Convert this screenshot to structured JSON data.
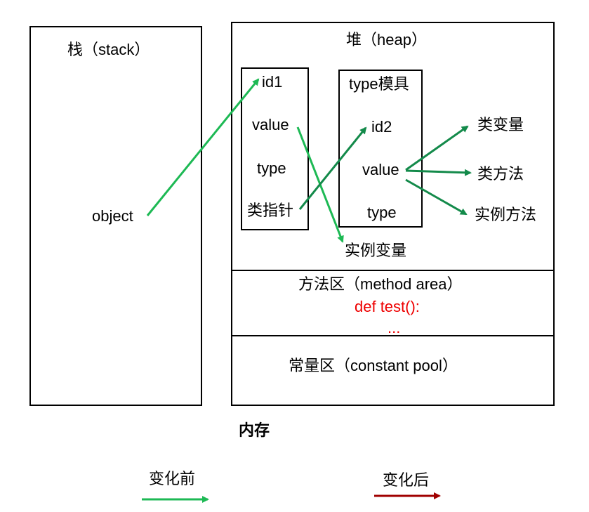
{
  "stack": {
    "title": "栈（stack）",
    "object": "object"
  },
  "heap": {
    "title": "堆（heap）",
    "obj1": {
      "id": "id1",
      "value": "value",
      "type": "type",
      "class_ptr": "类指针"
    },
    "obj2": {
      "type_template": "type模具",
      "id": "id2",
      "value": "value",
      "type": "type"
    },
    "instance_var": "实例变量",
    "class_var": "类变量",
    "class_method": "类方法",
    "instance_method": "实例方法"
  },
  "method_area": {
    "title": "方法区（method area）",
    "code": "def test():",
    "ellipsis": "..."
  },
  "constant_pool": {
    "title": "常量区（constant pool）"
  },
  "memory_label": "内存",
  "legend": {
    "before": {
      "label": "变化前",
      "color": "#1db954"
    },
    "after": {
      "label": "变化后",
      "color": "#a00000"
    }
  },
  "colors": {
    "arrow_light": "#1db954",
    "arrow_dark": "#138a4a"
  }
}
